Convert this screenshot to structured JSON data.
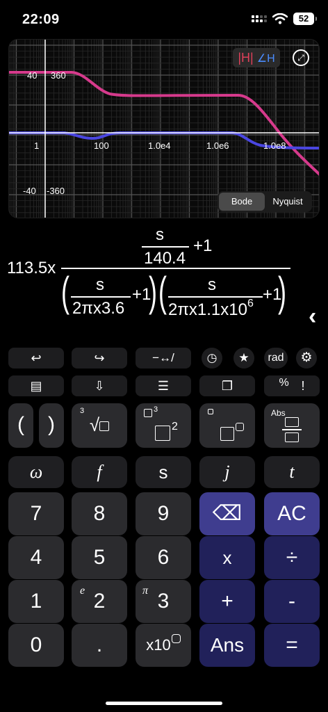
{
  "status": {
    "time": "22:09",
    "battery": "52"
  },
  "graph": {
    "y_left_labels": [
      "40",
      "-40"
    ],
    "y_right_labels": [
      "360",
      "-360"
    ],
    "x_labels": [
      "1",
      "100",
      "1.0e4",
      "1.0e6",
      "1.0e8"
    ],
    "badge_mag": "|H|",
    "badge_phase": "∠H",
    "tabs": [
      "Bode",
      "Nyquist"
    ],
    "active_tab": "Bode",
    "colors": {
      "magnitude": "#d63a8c",
      "phase": "#4a46e0",
      "badge_mag": "#e0405a",
      "badge_phase": "#4a8cff"
    }
  },
  "expression": {
    "coef": "113.5x",
    "top_num": "s",
    "top_den": "140.4",
    "plus1": "+1",
    "f1_num": "s",
    "f1_den": "2πx3.6",
    "f2_num": "s",
    "f2_den": "2πx1.1x10",
    "f2_exp": "6"
  },
  "toolbar": {
    "undo": "↩",
    "redo": "↪",
    "convert": "−↔/",
    "history": "◷",
    "favorite": "★",
    "angle": "rad",
    "settings": "⚙",
    "tray": "▤",
    "save": "⇩",
    "sliders": "☰",
    "windows": "❐",
    "percent": "%",
    "factorial": "!"
  },
  "keys": {
    "paren_open": "(",
    "paren_close": ")",
    "cbrt_index": "3",
    "sqrt": "√",
    "cube_exp": "3",
    "square_exp": "2",
    "abs": "Abs",
    "omega": "ω",
    "f": "f",
    "s": "s",
    "j": "j",
    "t": "t",
    "d7": "7",
    "d8": "8",
    "d9": "9",
    "d4": "4",
    "d5": "5",
    "d6": "6",
    "d1": "1",
    "d2": "2",
    "d3": "3",
    "d0": "0",
    "dot": ".",
    "x10": "x10",
    "backspace": "⌫",
    "ac": "AC",
    "times": "x",
    "divide": "÷",
    "plus": "+",
    "minus": "-",
    "ans": "Ans",
    "equals": "=",
    "e_label": "e",
    "pi_label": "π"
  }
}
